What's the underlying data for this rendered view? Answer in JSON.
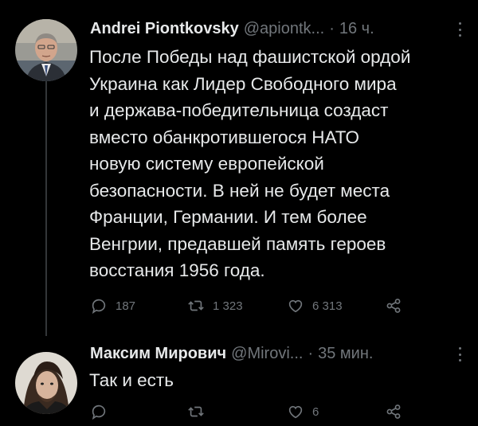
{
  "tweets": [
    {
      "author_name": "Andrei Piontkovsky",
      "handle": "@apiontk...",
      "separator": "·",
      "time": "16 ч.",
      "text": "После Победы над фашистской ордой\nУкраина как Лидер Свободного мира\nи держава-победительница создаст\nвместо обанкротившегося НАТО\nновую систему европейской\nбезопасности. В ней не будет места\nФранции, Германии. И тем более\nВенгрии, предавшей память героев\nвосстания 1956 года.",
      "replies": "187",
      "retweets": "1 323",
      "likes": "6 313"
    },
    {
      "author_name": "Максим Мирович",
      "handle": "@Mirovi...",
      "separator": "·",
      "time": "35 мин.",
      "text": "Так и есть",
      "replies": "",
      "retweets": "",
      "likes": "6"
    }
  ],
  "icons": {
    "reply": "reply-icon",
    "retweet": "retweet-icon",
    "like": "heart-icon",
    "share": "share-icon",
    "more": "more-options-icon"
  },
  "colors": {
    "background": "#000000",
    "text": "#e7e9ea",
    "secondary": "#71767b",
    "thread_line": "#333639"
  }
}
